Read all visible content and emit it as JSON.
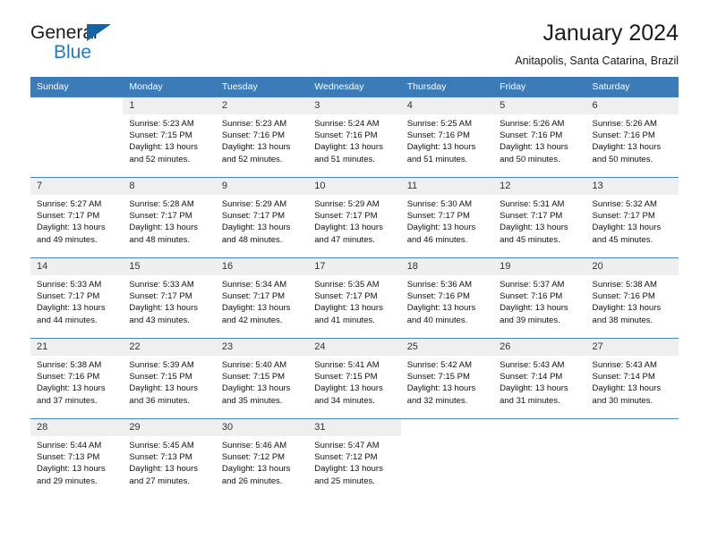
{
  "logo": {
    "text_primary": "General",
    "text_secondary": "Blue",
    "triangle_icon": "triangle-icon",
    "color_primary": "#1a1a1a",
    "color_secondary": "#1f7ac4",
    "color_triangle": "#1464a5"
  },
  "header": {
    "title": "January 2024",
    "subtitle": "Anitapolis, Santa Catarina, Brazil"
  },
  "theme": {
    "header_bg": "#3b7cb8",
    "daynum_bg": "#efefef",
    "cell_bg": "#ffffff",
    "text": "#111111"
  },
  "weekdays": [
    "Sunday",
    "Monday",
    "Tuesday",
    "Wednesday",
    "Thursday",
    "Friday",
    "Saturday"
  ],
  "weeks": [
    [
      {
        "day": "",
        "sunrise": "",
        "sunset": "",
        "daylight_1": "",
        "daylight_2": ""
      },
      {
        "day": "1",
        "sunrise": "Sunrise: 5:23 AM",
        "sunset": "Sunset: 7:15 PM",
        "daylight_1": "Daylight: 13 hours",
        "daylight_2": "and 52 minutes."
      },
      {
        "day": "2",
        "sunrise": "Sunrise: 5:23 AM",
        "sunset": "Sunset: 7:16 PM",
        "daylight_1": "Daylight: 13 hours",
        "daylight_2": "and 52 minutes."
      },
      {
        "day": "3",
        "sunrise": "Sunrise: 5:24 AM",
        "sunset": "Sunset: 7:16 PM",
        "daylight_1": "Daylight: 13 hours",
        "daylight_2": "and 51 minutes."
      },
      {
        "day": "4",
        "sunrise": "Sunrise: 5:25 AM",
        "sunset": "Sunset: 7:16 PM",
        "daylight_1": "Daylight: 13 hours",
        "daylight_2": "and 51 minutes."
      },
      {
        "day": "5",
        "sunrise": "Sunrise: 5:26 AM",
        "sunset": "Sunset: 7:16 PM",
        "daylight_1": "Daylight: 13 hours",
        "daylight_2": "and 50 minutes."
      },
      {
        "day": "6",
        "sunrise": "Sunrise: 5:26 AM",
        "sunset": "Sunset: 7:16 PM",
        "daylight_1": "Daylight: 13 hours",
        "daylight_2": "and 50 minutes."
      }
    ],
    [
      {
        "day": "7",
        "sunrise": "Sunrise: 5:27 AM",
        "sunset": "Sunset: 7:17 PM",
        "daylight_1": "Daylight: 13 hours",
        "daylight_2": "and 49 minutes."
      },
      {
        "day": "8",
        "sunrise": "Sunrise: 5:28 AM",
        "sunset": "Sunset: 7:17 PM",
        "daylight_1": "Daylight: 13 hours",
        "daylight_2": "and 48 minutes."
      },
      {
        "day": "9",
        "sunrise": "Sunrise: 5:29 AM",
        "sunset": "Sunset: 7:17 PM",
        "daylight_1": "Daylight: 13 hours",
        "daylight_2": "and 48 minutes."
      },
      {
        "day": "10",
        "sunrise": "Sunrise: 5:29 AM",
        "sunset": "Sunset: 7:17 PM",
        "daylight_1": "Daylight: 13 hours",
        "daylight_2": "and 47 minutes."
      },
      {
        "day": "11",
        "sunrise": "Sunrise: 5:30 AM",
        "sunset": "Sunset: 7:17 PM",
        "daylight_1": "Daylight: 13 hours",
        "daylight_2": "and 46 minutes."
      },
      {
        "day": "12",
        "sunrise": "Sunrise: 5:31 AM",
        "sunset": "Sunset: 7:17 PM",
        "daylight_1": "Daylight: 13 hours",
        "daylight_2": "and 45 minutes."
      },
      {
        "day": "13",
        "sunrise": "Sunrise: 5:32 AM",
        "sunset": "Sunset: 7:17 PM",
        "daylight_1": "Daylight: 13 hours",
        "daylight_2": "and 45 minutes."
      }
    ],
    [
      {
        "day": "14",
        "sunrise": "Sunrise: 5:33 AM",
        "sunset": "Sunset: 7:17 PM",
        "daylight_1": "Daylight: 13 hours",
        "daylight_2": "and 44 minutes."
      },
      {
        "day": "15",
        "sunrise": "Sunrise: 5:33 AM",
        "sunset": "Sunset: 7:17 PM",
        "daylight_1": "Daylight: 13 hours",
        "daylight_2": "and 43 minutes."
      },
      {
        "day": "16",
        "sunrise": "Sunrise: 5:34 AM",
        "sunset": "Sunset: 7:17 PM",
        "daylight_1": "Daylight: 13 hours",
        "daylight_2": "and 42 minutes."
      },
      {
        "day": "17",
        "sunrise": "Sunrise: 5:35 AM",
        "sunset": "Sunset: 7:17 PM",
        "daylight_1": "Daylight: 13 hours",
        "daylight_2": "and 41 minutes."
      },
      {
        "day": "18",
        "sunrise": "Sunrise: 5:36 AM",
        "sunset": "Sunset: 7:16 PM",
        "daylight_1": "Daylight: 13 hours",
        "daylight_2": "and 40 minutes."
      },
      {
        "day": "19",
        "sunrise": "Sunrise: 5:37 AM",
        "sunset": "Sunset: 7:16 PM",
        "daylight_1": "Daylight: 13 hours",
        "daylight_2": "and 39 minutes."
      },
      {
        "day": "20",
        "sunrise": "Sunrise: 5:38 AM",
        "sunset": "Sunset: 7:16 PM",
        "daylight_1": "Daylight: 13 hours",
        "daylight_2": "and 38 minutes."
      }
    ],
    [
      {
        "day": "21",
        "sunrise": "Sunrise: 5:38 AM",
        "sunset": "Sunset: 7:16 PM",
        "daylight_1": "Daylight: 13 hours",
        "daylight_2": "and 37 minutes."
      },
      {
        "day": "22",
        "sunrise": "Sunrise: 5:39 AM",
        "sunset": "Sunset: 7:15 PM",
        "daylight_1": "Daylight: 13 hours",
        "daylight_2": "and 36 minutes."
      },
      {
        "day": "23",
        "sunrise": "Sunrise: 5:40 AM",
        "sunset": "Sunset: 7:15 PM",
        "daylight_1": "Daylight: 13 hours",
        "daylight_2": "and 35 minutes."
      },
      {
        "day": "24",
        "sunrise": "Sunrise: 5:41 AM",
        "sunset": "Sunset: 7:15 PM",
        "daylight_1": "Daylight: 13 hours",
        "daylight_2": "and 34 minutes."
      },
      {
        "day": "25",
        "sunrise": "Sunrise: 5:42 AM",
        "sunset": "Sunset: 7:15 PM",
        "daylight_1": "Daylight: 13 hours",
        "daylight_2": "and 32 minutes."
      },
      {
        "day": "26",
        "sunrise": "Sunrise: 5:43 AM",
        "sunset": "Sunset: 7:14 PM",
        "daylight_1": "Daylight: 13 hours",
        "daylight_2": "and 31 minutes."
      },
      {
        "day": "27",
        "sunrise": "Sunrise: 5:43 AM",
        "sunset": "Sunset: 7:14 PM",
        "daylight_1": "Daylight: 13 hours",
        "daylight_2": "and 30 minutes."
      }
    ],
    [
      {
        "day": "28",
        "sunrise": "Sunrise: 5:44 AM",
        "sunset": "Sunset: 7:13 PM",
        "daylight_1": "Daylight: 13 hours",
        "daylight_2": "and 29 minutes."
      },
      {
        "day": "29",
        "sunrise": "Sunrise: 5:45 AM",
        "sunset": "Sunset: 7:13 PM",
        "daylight_1": "Daylight: 13 hours",
        "daylight_2": "and 27 minutes."
      },
      {
        "day": "30",
        "sunrise": "Sunrise: 5:46 AM",
        "sunset": "Sunset: 7:12 PM",
        "daylight_1": "Daylight: 13 hours",
        "daylight_2": "and 26 minutes."
      },
      {
        "day": "31",
        "sunrise": "Sunrise: 5:47 AM",
        "sunset": "Sunset: 7:12 PM",
        "daylight_1": "Daylight: 13 hours",
        "daylight_2": "and 25 minutes."
      },
      {
        "day": "",
        "sunrise": "",
        "sunset": "",
        "daylight_1": "",
        "daylight_2": ""
      },
      {
        "day": "",
        "sunrise": "",
        "sunset": "",
        "daylight_1": "",
        "daylight_2": ""
      },
      {
        "day": "",
        "sunrise": "",
        "sunset": "",
        "daylight_1": "",
        "daylight_2": ""
      }
    ]
  ]
}
